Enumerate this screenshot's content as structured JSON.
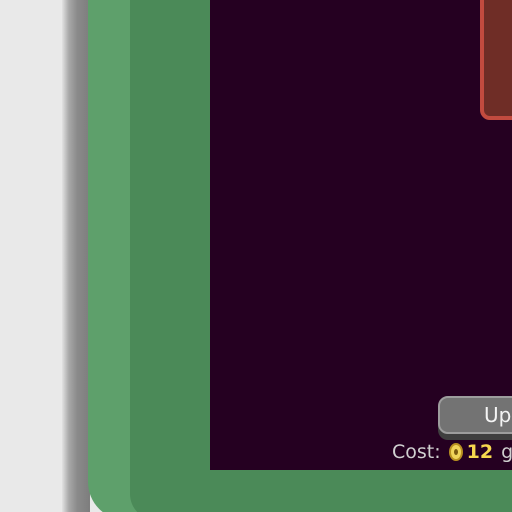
{
  "upgrade_button": {
    "label": "Up"
  },
  "cost": {
    "label": "Cost:",
    "value": "12",
    "suffix": "g"
  },
  "colors": {
    "frame_outer": "#5ea06b",
    "frame_inner": "#4b8a58",
    "panel": "#250021",
    "red_card_border": "#c24b3f",
    "cost_value": "#f6d84e"
  },
  "icons": {
    "coin": "gold-coin-icon"
  }
}
